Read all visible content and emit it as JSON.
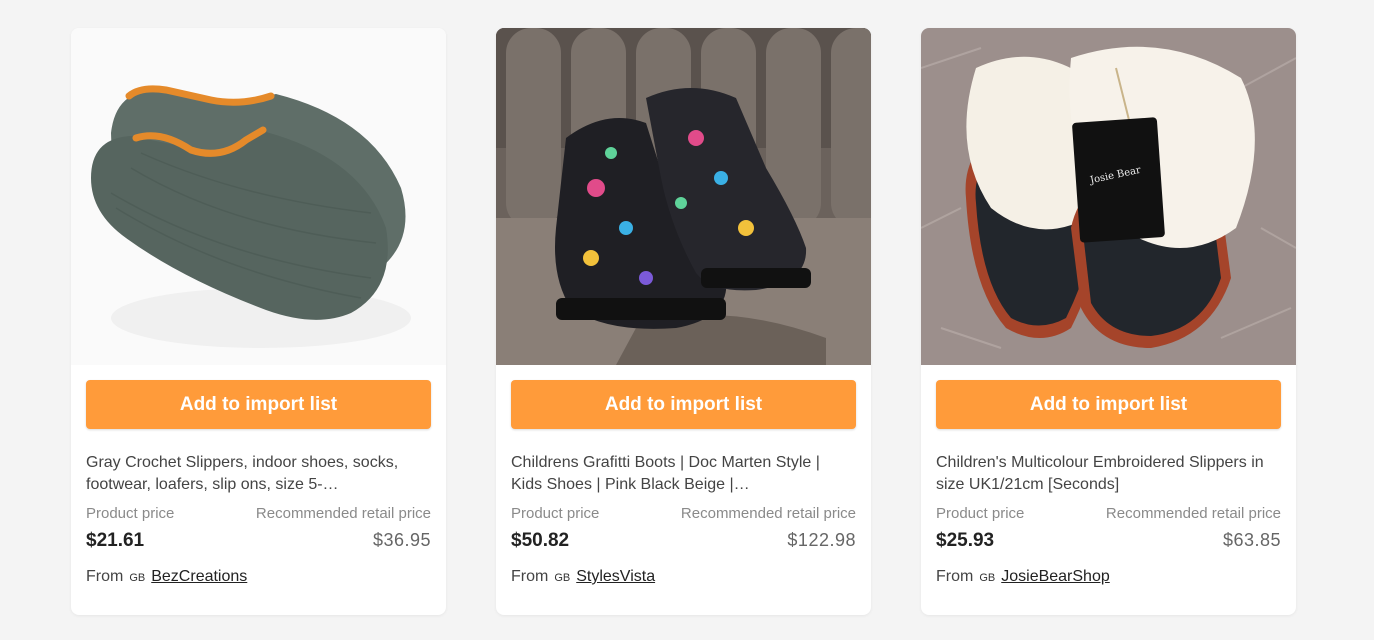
{
  "products": [
    {
      "button_label": "Add to import list",
      "title": "Gray Crochet Slippers, indoor shoes, socks, footwear, loafers, slip ons, size 5-…",
      "product_price_label": "Product price",
      "retail_price_label": "Recommended retail price",
      "product_price": "$21.61",
      "retail_price": "$36.95",
      "from_label": "From",
      "country": "GB",
      "seller": "BezCreations"
    },
    {
      "button_label": "Add to import list",
      "title": "Childrens Grafitti Boots | Doc Marten Style | Kids Shoes | Pink Black Beige |…",
      "product_price_label": "Product price",
      "retail_price_label": "Recommended retail price",
      "product_price": "$50.82",
      "retail_price": "$122.98",
      "from_label": "From",
      "country": "GB",
      "seller": "StylesVista"
    },
    {
      "button_label": "Add to import list",
      "title": "Children's Multicolour Embroidered Slippers in size UK1/21cm [Seconds]",
      "product_price_label": "Product price",
      "retail_price_label": "Recommended retail price",
      "product_price": "$25.93",
      "retail_price": "$63.85",
      "from_label": "From",
      "country": "GB",
      "seller": "JosieBearShop"
    }
  ],
  "colors": {
    "accent": "#ff9b3a",
    "background": "#f4f4f4",
    "card": "#ffffff"
  }
}
